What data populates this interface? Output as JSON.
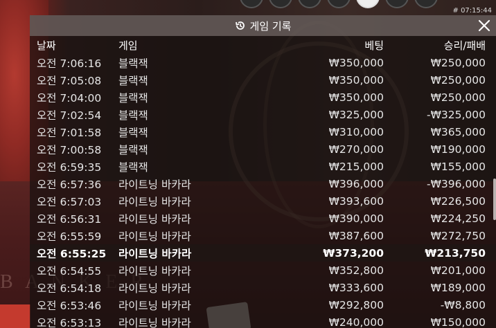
{
  "status": {
    "clock": "# 07:15:44"
  },
  "panel": {
    "title": "게임 기록",
    "columns": {
      "time": "날짜",
      "game": "게임",
      "bet": "베팅",
      "result": "승리/패배"
    }
  },
  "rows": [
    {
      "time": "오전 7:06:16",
      "game": "블랙잭",
      "bet": "₩350,000",
      "result": "₩250,000"
    },
    {
      "time": "오전 7:05:08",
      "game": "블랙잭",
      "bet": "₩350,000",
      "result": "₩250,000"
    },
    {
      "time": "오전 7:04:00",
      "game": "블랙잭",
      "bet": "₩350,000",
      "result": "₩250,000"
    },
    {
      "time": "오전 7:02:54",
      "game": "블랙잭",
      "bet": "₩325,000",
      "result": "-₩325,000"
    },
    {
      "time": "오전 7:01:58",
      "game": "블랙잭",
      "bet": "₩310,000",
      "result": "₩365,000"
    },
    {
      "time": "오전 7:00:58",
      "game": "블랙잭",
      "bet": "₩270,000",
      "result": "₩190,000"
    },
    {
      "time": "오전 6:59:35",
      "game": "블랙잭",
      "bet": "₩215,000",
      "result": "₩155,000"
    },
    {
      "time": "오전 6:57:36",
      "game": "라이트닝 바카라",
      "bet": "₩396,000",
      "result": "-₩396,000"
    },
    {
      "time": "오전 6:57:03",
      "game": "라이트닝 바카라",
      "bet": "₩393,600",
      "result": "₩226,500"
    },
    {
      "time": "오전 6:56:31",
      "game": "라이트닝 바카라",
      "bet": "₩390,000",
      "result": "₩224,250"
    },
    {
      "time": "오전 6:55:59",
      "game": "라이트닝 바카라",
      "bet": "₩387,600",
      "result": "₩272,750"
    },
    {
      "time": "오전 6:55:25",
      "game": "라이트닝 바카라",
      "bet": "₩373,200",
      "result": "₩213,750"
    },
    {
      "time": "오전 6:54:55",
      "game": "라이트닝 바카라",
      "bet": "₩352,800",
      "result": "₩201,000"
    },
    {
      "time": "오전 6:54:18",
      "game": "라이트닝 바카라",
      "bet": "₩333,600",
      "result": "₩189,000"
    },
    {
      "time": "오전 6:53:46",
      "game": "라이트닝 바카라",
      "bet": "₩292,800",
      "result": "-₩8,800"
    },
    {
      "time": "오전 6:53:13",
      "game": "라이트닝 바카라",
      "bet": "₩240,000",
      "result": "₩150,000"
    }
  ],
  "icons": {
    "title": "history-icon",
    "close": "close-icon"
  }
}
